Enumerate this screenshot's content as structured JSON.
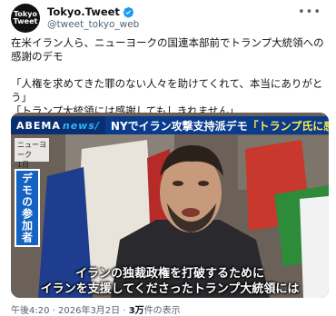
{
  "account": {
    "avatar_text_line1": "Tokyo",
    "avatar_text_line2": "Tweet",
    "display_name": "Tokyo.Tweet",
    "handle": "@tweet_tokyo_web"
  },
  "tweet": {
    "text": "在米イラン人ら、ニューヨークの国連本部前でトランプ大統領への感謝のデモ\n\n「人権を求めてきた罪のない人々を助けてくれて、本当にありがとう」\n「トランプ大統領には感謝してもしきれません」",
    "timestamp": "午後4:20 · 2026年3月2日",
    "views_count": "3万",
    "views_label": "件の表示"
  },
  "media": {
    "brand": "ABEMA",
    "brand_suffix": "news/",
    "headline_prefix": "NYでイラン攻撃支持派デモ",
    "headline_highlight": "「トランプ氏に感謝」",
    "location_line1": "ニューヨーク",
    "location_line2": "1日",
    "side_label": "デモの参加者",
    "subtitle_line1": "イランの独裁政権を打破するために",
    "subtitle_line2": "イランを支援してくださったトランプ大統領には"
  },
  "icons": {
    "verified": "verified-badge-icon",
    "menu": "more-options-icon"
  },
  "colors": {
    "verified": "#1d9bf0",
    "banner": "#0b3c8c",
    "side_label": "#1463c3",
    "highlight": "#ffe94f"
  }
}
